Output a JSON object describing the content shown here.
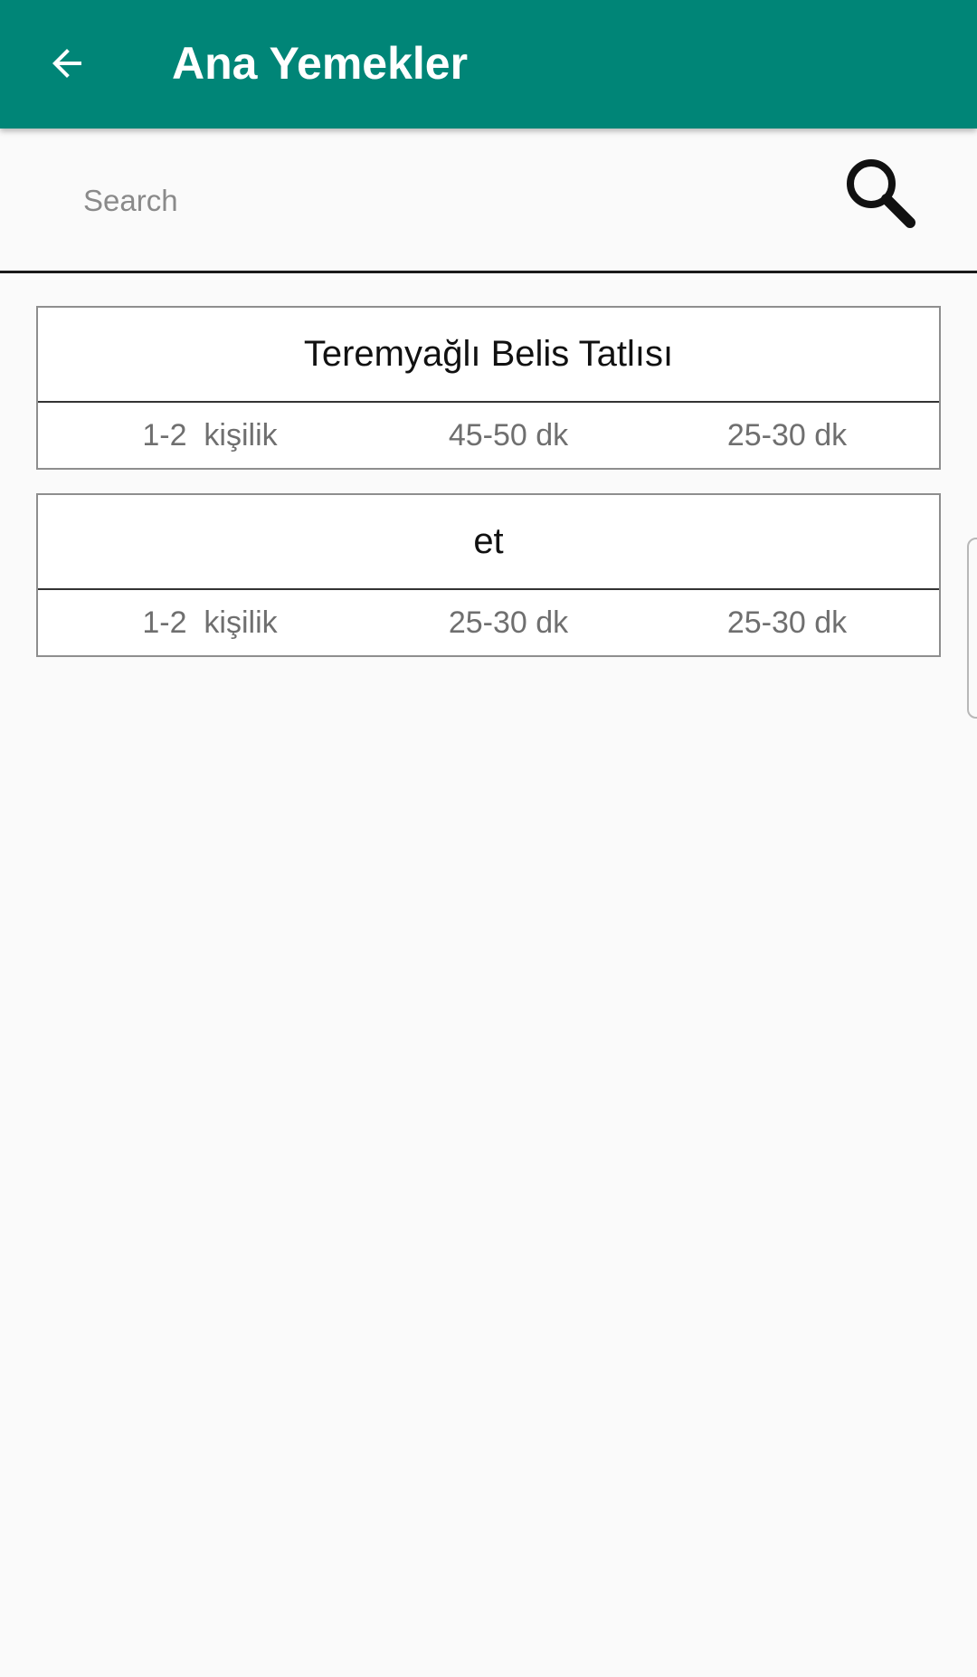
{
  "appbar": {
    "title": "Ana Yemekler",
    "background_color": "#008577",
    "back_icon": "arrow-left-icon"
  },
  "search": {
    "placeholder": "Search",
    "value": "",
    "icon": "search-icon"
  },
  "recipes": [
    {
      "name": "Teremyağlı Belis Tatlısı",
      "persons": "1-2  kişilik",
      "prep_time": "45-50 dk",
      "cook_time": "25-30 dk"
    },
    {
      "name": "et",
      "persons": "1-2  kişilik",
      "prep_time": "25-30 dk",
      "cook_time": "25-30 dk"
    }
  ]
}
